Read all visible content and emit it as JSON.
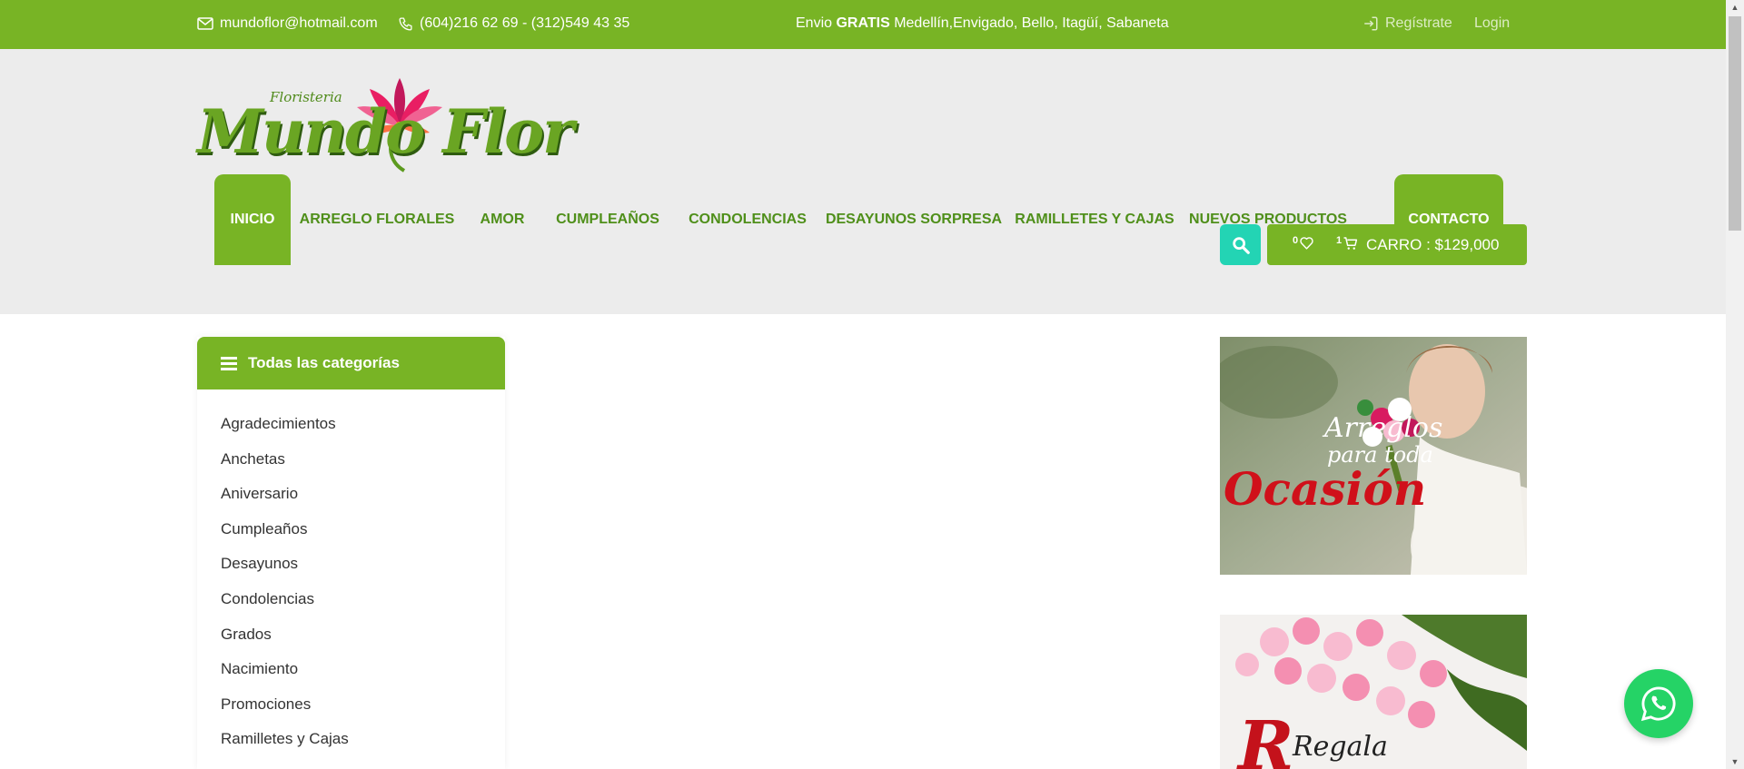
{
  "topbar": {
    "email": "mundoflor@hotmail.com",
    "phone": "(604)216 62 69 - (312)549 43 35",
    "shipping_prefix": "Envio",
    "shipping_bold": "GRATIS",
    "shipping_suffix": "Medellín,Envigado, Bello, Itagüí, Sabaneta",
    "register": "Regístrate",
    "login": "Login"
  },
  "logo": {
    "small": "Floristeria",
    "main": "Mundo Flor"
  },
  "nav": [
    {
      "label": "INICIO",
      "active": true
    },
    {
      "label": "ARREGLO FLORALES",
      "active": false
    },
    {
      "label": "AMOR",
      "active": false
    },
    {
      "label": "CUMPLEAÑOS",
      "active": false
    },
    {
      "label": "CONDOLENCIAS",
      "active": false
    },
    {
      "label": "DESAYUNOS SORPRESA",
      "active": false
    },
    {
      "label": "RAMILLETES Y CAJAS",
      "active": false
    },
    {
      "label": "NUEVOS PRODUCTOS",
      "active": false
    },
    {
      "label": "CONTACTO",
      "active": true
    }
  ],
  "cart": {
    "wishlist_count": "0",
    "cart_count": "1",
    "total": "CARRO : $129,000"
  },
  "categories": {
    "title": "Todas las categorías",
    "items": [
      "Agradecimientos",
      "Anchetas",
      "Aniversario",
      "Cumpleaños",
      "Desayunos",
      "Condolencias",
      "Grados",
      "Nacimiento",
      "Promociones",
      "Ramilletes y Cajas"
    ]
  },
  "banners": {
    "one_line1": "Arreglos",
    "one_line2": "para toda",
    "one_line3": "Ocasión",
    "two_line1": "Regala"
  },
  "colors": {
    "primary": "#78b425",
    "accent": "#23d4b4",
    "whatsapp": "#25d366",
    "header_bg": "#ececec"
  }
}
